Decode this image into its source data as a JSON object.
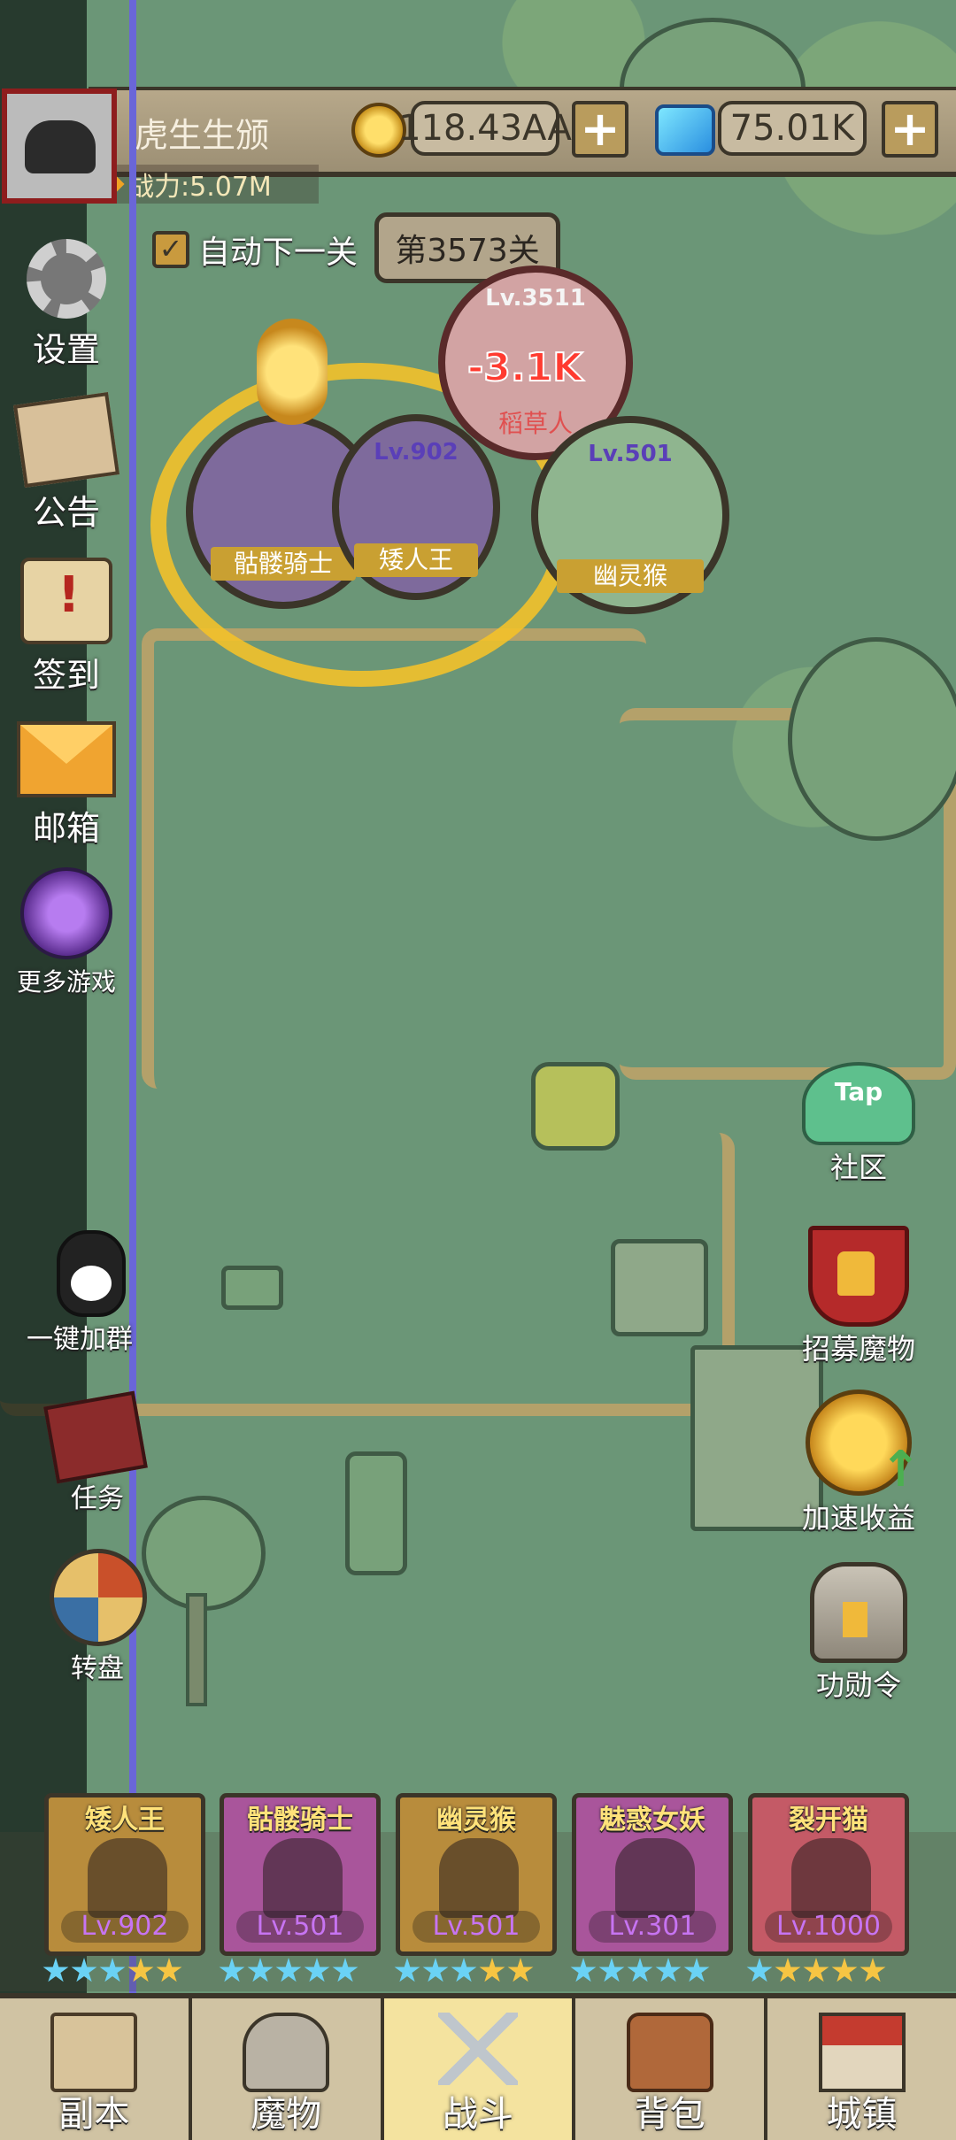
{
  "header": {
    "player_name": "虎生生颁",
    "coins": "118.43AA",
    "gems": "75.01K",
    "plus_label": "+",
    "power": "战力:5.07M"
  },
  "battle": {
    "auto_next_label": "自动下一关",
    "auto_next_checked": true,
    "checkmark": "✓",
    "stage_label": "第3573关",
    "damage_text": "-3.1K",
    "units": [
      {
        "name": "骷髅骑士",
        "level": ""
      },
      {
        "name": "矮人王",
        "level": "Lv.902"
      },
      {
        "name": "稻草人",
        "level": "Lv.3511"
      },
      {
        "name": "幽灵猴",
        "level": "Lv.501"
      }
    ]
  },
  "sidebar": {
    "items": [
      {
        "label": "设置",
        "icon": "gear-icon"
      },
      {
        "label": "公告",
        "icon": "notice-icon"
      },
      {
        "label": "签到",
        "icon": "scroll-icon"
      },
      {
        "label": "邮箱",
        "icon": "mail-icon"
      },
      {
        "label": "更多游戏",
        "icon": "more-games-icon"
      }
    ],
    "lower": [
      {
        "label": "一键加群",
        "icon": "qq-penguin-icon"
      },
      {
        "label": "任务",
        "icon": "book-icon"
      },
      {
        "label": "转盘",
        "icon": "wheel-icon"
      }
    ]
  },
  "right_panel": {
    "items": [
      {
        "label": "社区",
        "icon": "tap-community-icon",
        "badge": "Tap"
      },
      {
        "label": "招募魔物",
        "icon": "recruit-banner-icon"
      },
      {
        "label": "加速收益",
        "icon": "coin-boost-icon"
      },
      {
        "label": "功勋令",
        "icon": "helmet-icon"
      }
    ]
  },
  "team": [
    {
      "name": "矮人王",
      "level": "Lv.902",
      "bg": "#b88c3c"
    },
    {
      "name": "骷髅骑士",
      "level": "Lv.501",
      "bg": "#a9559b"
    },
    {
      "name": "幽灵猴",
      "level": "Lv.501",
      "bg": "#b88c3c"
    },
    {
      "name": "魅惑女妖",
      "level": "Lv.301",
      "bg": "#a9559b"
    },
    {
      "name": "裂开猫",
      "level": "Lv.1000",
      "bg": "#c45a66"
    }
  ],
  "bottom_nav": {
    "tabs": [
      {
        "label": "副本",
        "icon": "map-icon",
        "active": false
      },
      {
        "label": "魔物",
        "icon": "monster-icon",
        "active": false
      },
      {
        "label": "战斗",
        "icon": "battle-swords-icon",
        "active": true
      },
      {
        "label": "背包",
        "icon": "backpack-icon",
        "active": false
      },
      {
        "label": "城镇",
        "icon": "town-icon",
        "active": false
      }
    ]
  }
}
